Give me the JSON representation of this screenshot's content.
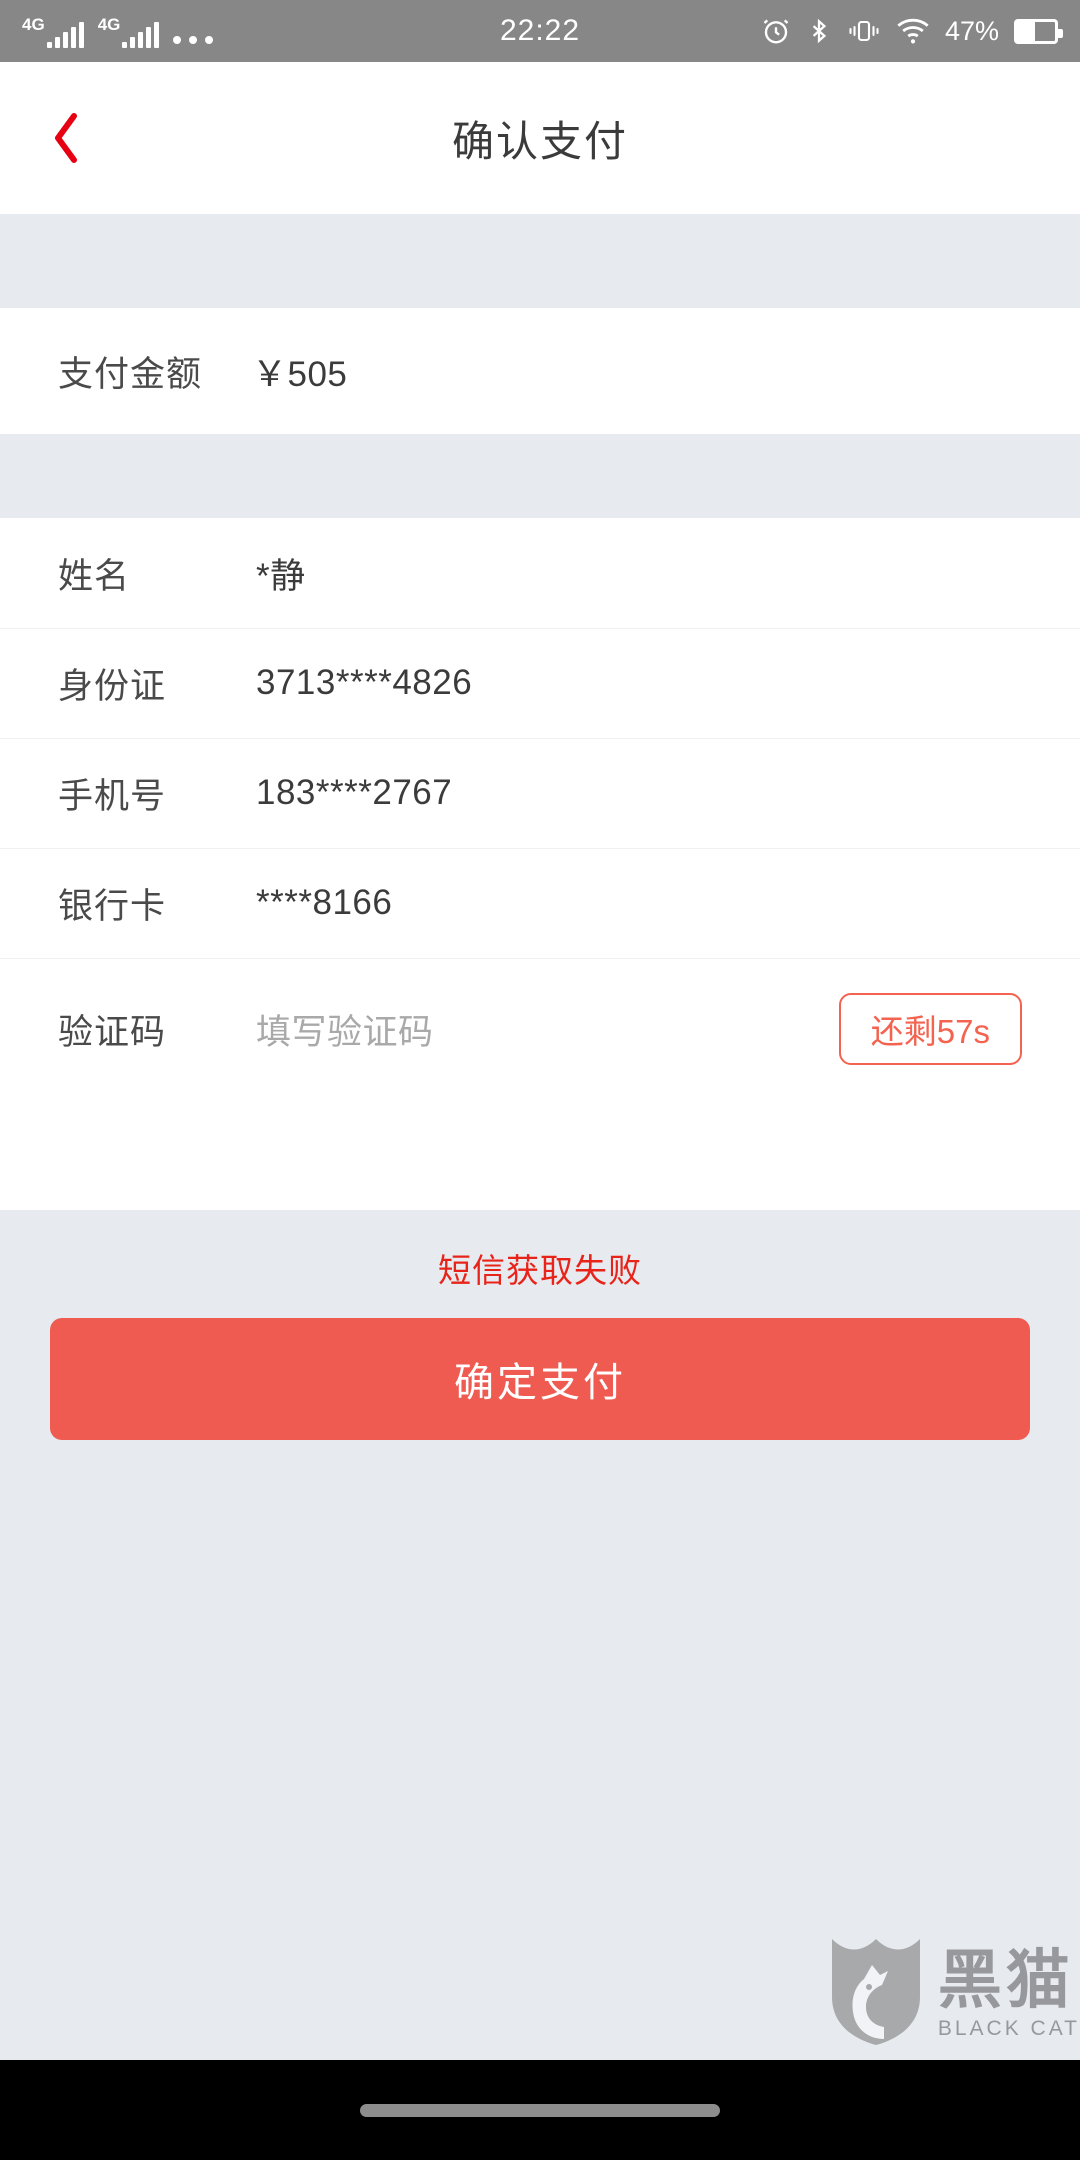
{
  "status_bar": {
    "network_1": "4G",
    "network_2": "4G",
    "more_indicator": "•••",
    "time": "22:22",
    "battery_percent": "47%",
    "icons": [
      "alarm-icon",
      "bluetooth-icon",
      "vibrate-icon",
      "wifi-icon",
      "battery-icon"
    ]
  },
  "header": {
    "title": "确认支付",
    "back_icon": "chevron-left-icon",
    "back_color": "#e60012"
  },
  "amount_section": {
    "label": "支付金额",
    "value": "￥505"
  },
  "details": {
    "rows": [
      {
        "label": "姓名",
        "value": "*静"
      },
      {
        "label": "身份证",
        "value": "3713****4826"
      },
      {
        "label": "手机号",
        "value": "183****2767"
      },
      {
        "label": "银行卡",
        "value": "****8166"
      }
    ],
    "code_row": {
      "label": "验证码",
      "placeholder": "填写验证码",
      "value": "",
      "countdown_label": "还剩57s"
    }
  },
  "error_message": "短信获取失败",
  "primary_button": {
    "label": "确定支付",
    "color": "#ef5a51"
  },
  "watermark": {
    "cn": "黑猫",
    "en": "BLACK CAT",
    "icon": "black-cat-shield-logo"
  },
  "colors": {
    "accent_red": "#f4634f",
    "error_red": "#e8241a",
    "page_bg": "#e7eaef",
    "card_bg": "#ffffff",
    "status_bar_bg": "#878787"
  }
}
